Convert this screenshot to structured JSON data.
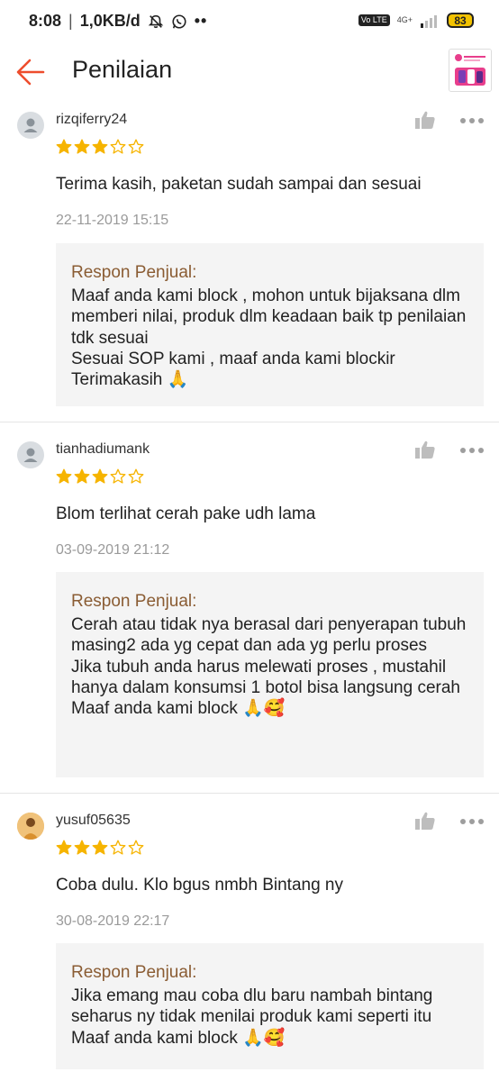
{
  "status_bar": {
    "time": "8:08",
    "separator": "|",
    "speed": "1,0KB/d",
    "network": "4G+",
    "volte": "Vo LTE",
    "battery": "83"
  },
  "header": {
    "title": "Penilaian"
  },
  "reviews": [
    {
      "username": "rizqiferry24",
      "rating": 3,
      "comment": "Terima kasih, paketan sudah sampai dan sesuai",
      "date": "22-11-2019 15:15",
      "response_label": "Respon Penjual:",
      "response_text": "Maaf anda kami block , mohon untuk bijaksana dlm memberi nilai, produk dlm keadaan baik tp penilaian tdk sesuai\nSesuai SOP kami , maaf anda kami blockir\nTerimakasih 🙏"
    },
    {
      "username": "tianhadiumank",
      "rating": 3,
      "comment": "Blom terlihat cerah pake udh lama",
      "date": "03-09-2019 21:12",
      "response_label": "Respon Penjual:",
      "response_text": "Cerah atau tidak nya berasal dari penyerapan tubuh masing2 ada yg cepat dan ada yg perlu proses\nJika tubuh anda harus melewati proses , mustahil hanya dalam konsumsi 1 botol bisa langsung cerah\nMaaf anda kami block 🙏🥰"
    },
    {
      "username": "yusuf05635",
      "rating": 3,
      "comment": "Coba dulu.  Klo bgus nmbh Bintang ny",
      "date": "30-08-2019 22:17",
      "response_label": "Respon Penjual:",
      "response_text": "Jika emang mau coba dlu baru nambah bintang seharus ny tidak menilai produk kami seperti itu\nMaaf anda kami block 🙏🥰"
    }
  ],
  "colors": {
    "accent": "#ee4d2d",
    "star": "#f6b400",
    "response_label": "#8a5c33",
    "date": "#9a9a9a",
    "response_bg": "#f4f4f4"
  }
}
